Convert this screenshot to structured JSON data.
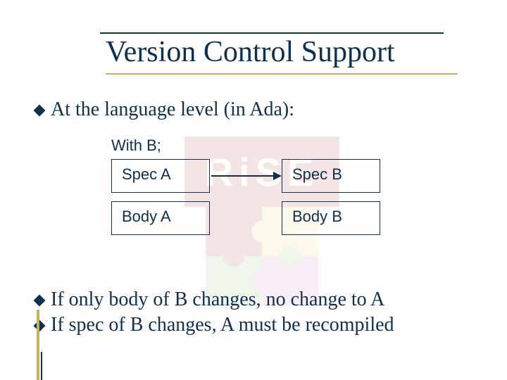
{
  "title": "Version Control Support",
  "bullets": {
    "b1": "At the language level (in Ada):",
    "b2": "If only body of B changes, no change to A",
    "b3": "If spec of B changes, A must be recompiled"
  },
  "diagram": {
    "withLabel": "With B;",
    "specA": "Spec A",
    "bodyA": "Body A",
    "specB": "Spec B",
    "bodyB": "Body B"
  },
  "logo": {
    "text": "RiSE"
  }
}
